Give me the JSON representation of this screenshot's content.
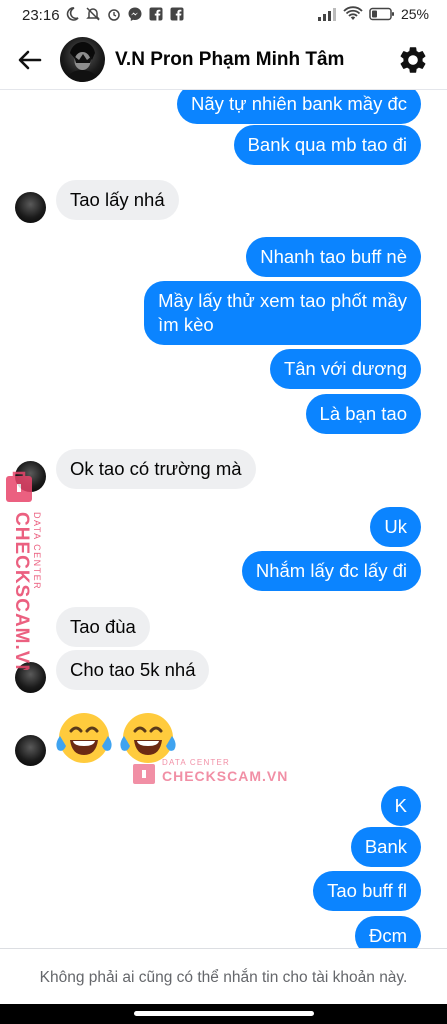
{
  "status_bar": {
    "time": "23:16",
    "battery": "25%",
    "left_icons": [
      "moon-icon",
      "mute-icon",
      "alarm-icon",
      "messenger-icon",
      "facebook-icon",
      "facebook-icon"
    ],
    "right_icons": [
      "signal-icon",
      "wifi-icon",
      "battery-icon"
    ]
  },
  "header": {
    "contact_name": "V.N Pron Phạm Minh Tâm",
    "back_icon": "arrow-left-icon",
    "settings_icon": "gear-icon"
  },
  "colors": {
    "outgoing_bubble": "#0b84ff",
    "incoming_bubble": "#eeeff1",
    "watermark": "#e8456b"
  },
  "messages": [
    {
      "direction": "out",
      "text": "Nãy tự nhiên bank mầy đc"
    },
    {
      "direction": "out",
      "text": "Bank qua mb tao đi"
    },
    {
      "direction": "in",
      "text": "Tao lấy nhá"
    },
    {
      "direction": "out",
      "text": "Nhanh tao buff nè"
    },
    {
      "direction": "out",
      "text": "Mầy lấy thử xem tao phốt mầy ìm kèo",
      "lines": [
        "Mầy lấy thử xem tao phốt mầy",
        "ìm kèo"
      ]
    },
    {
      "direction": "out",
      "text": "Tân với dương"
    },
    {
      "direction": "out",
      "text": "Là bạn tao"
    },
    {
      "direction": "in",
      "text": "Ok tao có trường mà"
    },
    {
      "direction": "out",
      "text": "Uk"
    },
    {
      "direction": "out",
      "text": "Nhắm lấy đc lấy đi"
    },
    {
      "direction": "in",
      "text": "Tao đùa"
    },
    {
      "direction": "in",
      "text": "Cho tao 5k nhá"
    },
    {
      "direction": "in",
      "emoji": [
        "face-with-tears-of-joy",
        "face-with-tears-of-joy"
      ]
    },
    {
      "direction": "out",
      "text": "K"
    },
    {
      "direction": "out",
      "text": "Bank"
    },
    {
      "direction": "out",
      "text": "Tao buff fl"
    },
    {
      "direction": "out",
      "text": "Đcm"
    }
  ],
  "watermark": {
    "line1": "DATA CENTER",
    "line2": "CHECKSCAM.VN"
  },
  "footer": {
    "notice": "Không phải ai cũng có thể nhắn tin cho tài khoản này."
  }
}
